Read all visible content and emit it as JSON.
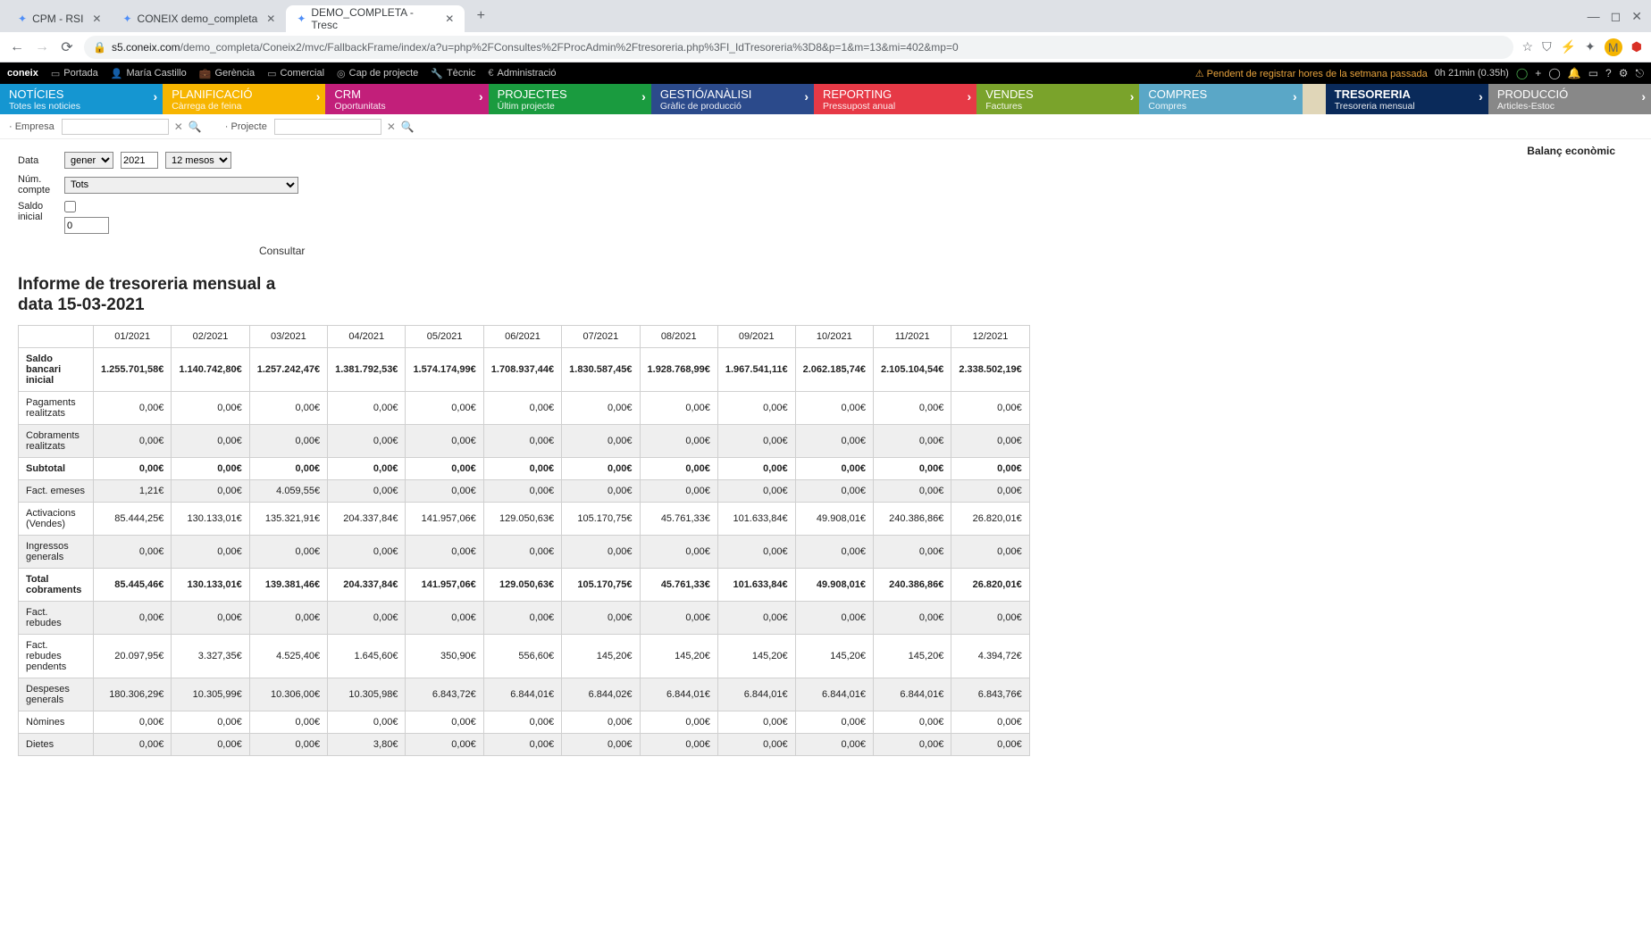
{
  "browser": {
    "tabs": [
      {
        "title": "CPM - RSI",
        "active": false
      },
      {
        "title": "CONEIX demo_completa",
        "active": false
      },
      {
        "title": "DEMO_COMPLETA - Tresc",
        "active": true
      }
    ],
    "url_domain": "s5.coneix.com",
    "url_path": "/demo_completa/Coneix2/mvc/FallbackFrame/index/a?u=php%2FConsultes%2FProcAdmin%2Ftresoreria.php%3FI_IdTresoreria%3D8&p=1&m=13&mi=402&mp=0"
  },
  "appbar": {
    "brand": "coneix",
    "items": [
      "Portada",
      "María Castillo",
      "Gerència",
      "Comercial",
      "Cap de projecte",
      "Tècnic",
      "Administració"
    ],
    "warning": "Pendent de registrar hores de la setmana passada",
    "time": "0h 21min (0.35h)"
  },
  "modules": [
    {
      "cls": "noticies",
      "title": "NOTÍCIES",
      "sub": "Totes les noticies"
    },
    {
      "cls": "planificacio",
      "title": "PLANIFICACIÓ",
      "sub": "Càrrega de feina"
    },
    {
      "cls": "crm",
      "title": "CRM",
      "sub": "Oportunitats"
    },
    {
      "cls": "projectes",
      "title": "PROJECTES",
      "sub": "Últim projecte"
    },
    {
      "cls": "gestio",
      "title": "GESTIÓ/ANÀLISI",
      "sub": "Gràfic de producció"
    },
    {
      "cls": "reporting",
      "title": "REPORTING",
      "sub": "Pressupost anual"
    },
    {
      "cls": "vendes",
      "title": "VENDES",
      "sub": "Factures"
    },
    {
      "cls": "compres",
      "title": "COMPRES",
      "sub": "Compres"
    },
    {
      "cls": "tresoreria",
      "title": "TRESORERIA",
      "sub": "Tresoreria mensual"
    },
    {
      "cls": "produccio",
      "title": "PRODUCCIÓ",
      "sub": "Articles-Estoc"
    }
  ],
  "filters": {
    "empresa_label": "· Empresa",
    "projecte_label": "· Projecte"
  },
  "form": {
    "data_label": "Data",
    "month": "gener",
    "year": "2021",
    "range": "12 mesos",
    "num_compte_label": "Núm. compte",
    "num_compte_value": "Tots",
    "saldo_label": "Saldo inicial",
    "saldo_value": "0",
    "consultar": "Consultar"
  },
  "balance_link": "Balanç econòmic",
  "report_title": "Informe de tresoreria mensual a data 15-03-2021",
  "table": {
    "months": [
      "01/2021",
      "02/2021",
      "03/2021",
      "04/2021",
      "05/2021",
      "06/2021",
      "07/2021",
      "08/2021",
      "09/2021",
      "10/2021",
      "11/2021",
      "12/2021"
    ],
    "rows": [
      {
        "label": "Saldo bancari inicial",
        "bold": true,
        "zebra": false,
        "values": [
          "1.255.701,58€",
          "1.140.742,80€",
          "1.257.242,47€",
          "1.381.792,53€",
          "1.574.174,99€",
          "1.708.937,44€",
          "1.830.587,45€",
          "1.928.768,99€",
          "1.967.541,11€",
          "2.062.185,74€",
          "2.105.104,54€",
          "2.338.502,19€"
        ]
      },
      {
        "label": "Pagaments realitzats",
        "bold": false,
        "zebra": false,
        "values": [
          "0,00€",
          "0,00€",
          "0,00€",
          "0,00€",
          "0,00€",
          "0,00€",
          "0,00€",
          "0,00€",
          "0,00€",
          "0,00€",
          "0,00€",
          "0,00€"
        ]
      },
      {
        "label": "Cobraments realitzats",
        "bold": false,
        "zebra": true,
        "values": [
          "0,00€",
          "0,00€",
          "0,00€",
          "0,00€",
          "0,00€",
          "0,00€",
          "0,00€",
          "0,00€",
          "0,00€",
          "0,00€",
          "0,00€",
          "0,00€"
        ]
      },
      {
        "label": "Subtotal",
        "bold": true,
        "zebra": false,
        "values": [
          "0,00€",
          "0,00€",
          "0,00€",
          "0,00€",
          "0,00€",
          "0,00€",
          "0,00€",
          "0,00€",
          "0,00€",
          "0,00€",
          "0,00€",
          "0,00€"
        ]
      },
      {
        "label": "Fact. emeses",
        "bold": false,
        "zebra": true,
        "values": [
          "1,21€",
          "0,00€",
          "4.059,55€",
          "0,00€",
          "0,00€",
          "0,00€",
          "0,00€",
          "0,00€",
          "0,00€",
          "0,00€",
          "0,00€",
          "0,00€"
        ]
      },
      {
        "label": "Activacions (Vendes)",
        "bold": false,
        "zebra": false,
        "values": [
          "85.444,25€",
          "130.133,01€",
          "135.321,91€",
          "204.337,84€",
          "141.957,06€",
          "129.050,63€",
          "105.170,75€",
          "45.761,33€",
          "101.633,84€",
          "49.908,01€",
          "240.386,86€",
          "26.820,01€"
        ]
      },
      {
        "label": "Ingressos generals",
        "bold": false,
        "zebra": true,
        "values": [
          "0,00€",
          "0,00€",
          "0,00€",
          "0,00€",
          "0,00€",
          "0,00€",
          "0,00€",
          "0,00€",
          "0,00€",
          "0,00€",
          "0,00€",
          "0,00€"
        ]
      },
      {
        "label": "Total cobraments",
        "bold": true,
        "zebra": false,
        "values": [
          "85.445,46€",
          "130.133,01€",
          "139.381,46€",
          "204.337,84€",
          "141.957,06€",
          "129.050,63€",
          "105.170,75€",
          "45.761,33€",
          "101.633,84€",
          "49.908,01€",
          "240.386,86€",
          "26.820,01€"
        ]
      },
      {
        "label": "Fact. rebudes",
        "bold": false,
        "zebra": true,
        "values": [
          "0,00€",
          "0,00€",
          "0,00€",
          "0,00€",
          "0,00€",
          "0,00€",
          "0,00€",
          "0,00€",
          "0,00€",
          "0,00€",
          "0,00€",
          "0,00€"
        ]
      },
      {
        "label": "Fact. rebudes pendents",
        "bold": false,
        "zebra": false,
        "values": [
          "20.097,95€",
          "3.327,35€",
          "4.525,40€",
          "1.645,60€",
          "350,90€",
          "556,60€",
          "145,20€",
          "145,20€",
          "145,20€",
          "145,20€",
          "145,20€",
          "4.394,72€"
        ]
      },
      {
        "label": "Despeses generals",
        "bold": false,
        "zebra": true,
        "values": [
          "180.306,29€",
          "10.305,99€",
          "10.306,00€",
          "10.305,98€",
          "6.843,72€",
          "6.844,01€",
          "6.844,02€",
          "6.844,01€",
          "6.844,01€",
          "6.844,01€",
          "6.844,01€",
          "6.843,76€"
        ]
      },
      {
        "label": "Nòmines",
        "bold": false,
        "zebra": false,
        "values": [
          "0,00€",
          "0,00€",
          "0,00€",
          "0,00€",
          "0,00€",
          "0,00€",
          "0,00€",
          "0,00€",
          "0,00€",
          "0,00€",
          "0,00€",
          "0,00€"
        ]
      },
      {
        "label": "Dietes",
        "bold": false,
        "zebra": true,
        "values": [
          "0,00€",
          "0,00€",
          "0,00€",
          "3,80€",
          "0,00€",
          "0,00€",
          "0,00€",
          "0,00€",
          "0,00€",
          "0,00€",
          "0,00€",
          "0,00€"
        ]
      }
    ]
  }
}
